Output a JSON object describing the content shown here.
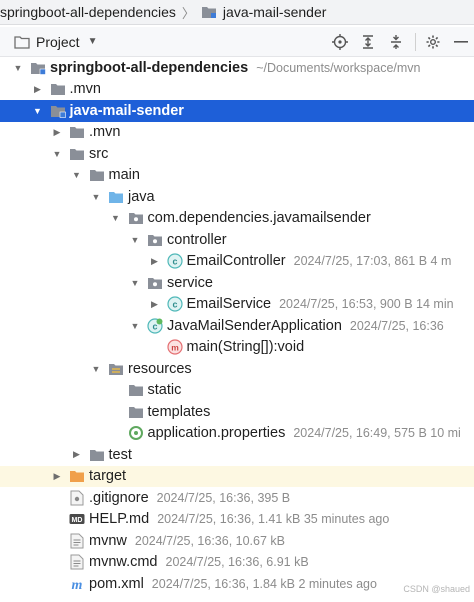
{
  "breadcrumb": {
    "items": [
      "springboot-all-dependencies",
      "java-mail-sender"
    ]
  },
  "toolbar": {
    "title": "Project",
    "icons": [
      "target-icon",
      "expand-all-icon",
      "collapse-all-icon",
      "gear-icon",
      "minimize-icon"
    ]
  },
  "tree": [
    {
      "label": "springboot-all-dependencies",
      "meta": "~/Documents/workspace/mvn",
      "icon": "module-folder",
      "indent": 0,
      "arrow": "down",
      "bold": true
    },
    {
      "label": ".mvn",
      "meta": "",
      "icon": "folder",
      "indent": 1,
      "arrow": "right"
    },
    {
      "label": "java-mail-sender",
      "meta": "",
      "icon": "module-folder",
      "indent": 1,
      "arrow": "down",
      "bold": true,
      "selected": true
    },
    {
      "label": ".mvn",
      "meta": "",
      "icon": "folder",
      "indent": 2,
      "arrow": "right"
    },
    {
      "label": "src",
      "meta": "",
      "icon": "folder",
      "indent": 2,
      "arrow": "down"
    },
    {
      "label": "main",
      "meta": "",
      "icon": "folder",
      "indent": 3,
      "arrow": "down"
    },
    {
      "label": "java",
      "meta": "",
      "icon": "source-folder",
      "indent": 4,
      "arrow": "down"
    },
    {
      "label": "com.dependencies.javamailsender",
      "meta": "",
      "icon": "package",
      "indent": 5,
      "arrow": "down"
    },
    {
      "label": "controller",
      "meta": "",
      "icon": "package",
      "indent": 6,
      "arrow": "down"
    },
    {
      "label": "EmailController",
      "meta": "2024/7/25, 17:03, 861 B 4 m",
      "icon": "class",
      "indent": 7,
      "arrow": "right"
    },
    {
      "label": "service",
      "meta": "",
      "icon": "package",
      "indent": 6,
      "arrow": "down"
    },
    {
      "label": "EmailService",
      "meta": "2024/7/25, 16:53, 900 B 14 min",
      "icon": "class",
      "indent": 7,
      "arrow": "right"
    },
    {
      "label": "JavaMailSenderApplication",
      "meta": "2024/7/25, 16:36",
      "icon": "spring-class",
      "indent": 6,
      "arrow": "down"
    },
    {
      "label": "main(String[]):void",
      "meta": "",
      "icon": "method",
      "indent": 7,
      "arrow": "none"
    },
    {
      "label": "resources",
      "meta": "",
      "icon": "resources-folder",
      "indent": 4,
      "arrow": "down"
    },
    {
      "label": "static",
      "meta": "",
      "icon": "folder",
      "indent": 5,
      "arrow": "none"
    },
    {
      "label": "templates",
      "meta": "",
      "icon": "folder",
      "indent": 5,
      "arrow": "none"
    },
    {
      "label": "application.properties",
      "meta": "2024/7/25, 16:49, 575 B 10 mi",
      "icon": "properties",
      "indent": 5,
      "arrow": "none"
    },
    {
      "label": "test",
      "meta": "",
      "icon": "folder",
      "indent": 3,
      "arrow": "right"
    },
    {
      "label": "target",
      "meta": "",
      "icon": "excluded-folder",
      "indent": 2,
      "arrow": "right",
      "excluded": true
    },
    {
      "label": ".gitignore",
      "meta": "2024/7/25, 16:36, 395 B",
      "icon": "gitignore",
      "indent": 2,
      "arrow": "none"
    },
    {
      "label": "HELP.md",
      "meta": "2024/7/25, 16:36, 1.41 kB 35 minutes ago",
      "icon": "markdown",
      "indent": 2,
      "arrow": "none"
    },
    {
      "label": "mvnw",
      "meta": "2024/7/25, 16:36, 10.67 kB",
      "icon": "text-file",
      "indent": 2,
      "arrow": "none"
    },
    {
      "label": "mvnw.cmd",
      "meta": "2024/7/25, 16:36, 6.91 kB",
      "icon": "text-file",
      "indent": 2,
      "arrow": "none"
    },
    {
      "label": "pom.xml",
      "meta": "2024/7/25, 16:36, 1.84 kB 2 minutes ago",
      "icon": "maven",
      "indent": 2,
      "arrow": "none"
    }
  ],
  "watermark": "CSDN @shaued",
  "colors": {
    "selection": "#1e5fd8",
    "folder": "#8a8f98",
    "source_folder": "#6fb4e8",
    "excluded_folder": "#f0a04b",
    "class_icon": "#4fb8b8",
    "method_icon": "#e46f72"
  }
}
